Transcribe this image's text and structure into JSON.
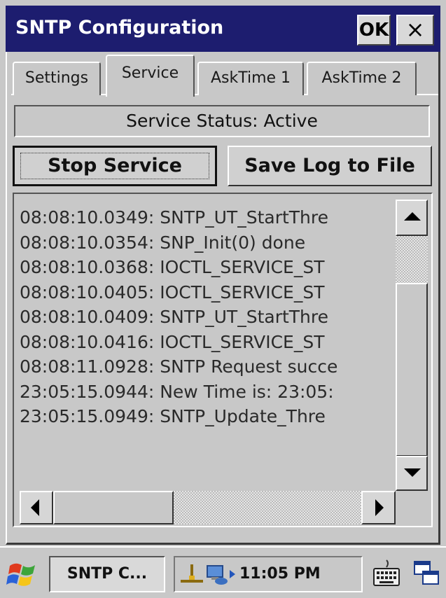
{
  "window": {
    "title": "SNTP Configuration",
    "ok_label": "OK",
    "close_label": "×"
  },
  "tabs": [
    {
      "label": "Settings",
      "active": false
    },
    {
      "label": "Service",
      "active": true
    },
    {
      "label": "AskTime 1",
      "active": false
    },
    {
      "label": "AskTime 2",
      "active": false
    }
  ],
  "service": {
    "status_text": "Service Status: Active",
    "stop_button_label": "Stop Service",
    "save_log_button_label": "Save Log to File"
  },
  "log": {
    "lines": [
      "08:08:10.0349: SNTP_UT_StartThre",
      "08:08:10.0354: SNP_Init(0) done",
      "08:08:10.0368: IOCTL_SERVICE_ST",
      "08:08:10.0405: IOCTL_SERVICE_ST",
      "08:08:10.0409: SNTP_UT_StartThre",
      "08:08:10.0416: IOCTL_SERVICE_ST",
      "08:08:11.0928: SNTP Request succe",
      "23:05:15.0944: New Time is: 23:05:",
      "23:05:15.0949: SNTP_Update_Thre"
    ]
  },
  "taskbar": {
    "task_label": "SNTP C...",
    "clock": "11:05 PM",
    "icons": [
      "windows-start-icon",
      "network-icon",
      "computer-icon",
      "tray-arrow-icon",
      "keyboard-icon",
      "desktop-icon"
    ]
  },
  "colors": {
    "titlebar": "#1d1d6f",
    "background": "#c8c8c8"
  }
}
